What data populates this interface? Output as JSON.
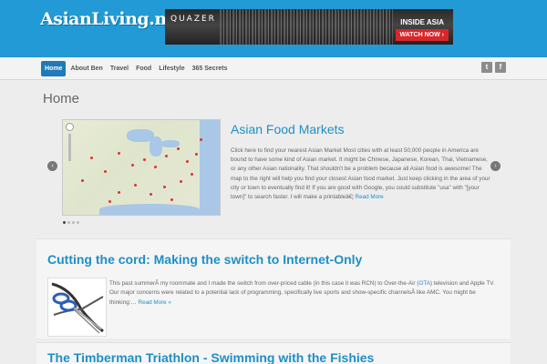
{
  "site": {
    "logo_text": "AsianLiving.me"
  },
  "ad": {
    "brand": "QUAZER",
    "headline": "INSIDE ASIA",
    "cta": "WATCH NOW ›"
  },
  "nav": {
    "items": [
      {
        "label": "Home",
        "active": true
      },
      {
        "label": "About Ben",
        "active": false
      },
      {
        "label": "Travel",
        "active": false
      },
      {
        "label": "Food",
        "active": false
      },
      {
        "label": "Lifestyle",
        "active": false
      },
      {
        "label": "365 Secrets",
        "active": false
      }
    ],
    "social": [
      {
        "name": "twitter",
        "glyph": "t"
      },
      {
        "name": "facebook",
        "glyph": "f"
      }
    ]
  },
  "page": {
    "title": "Home"
  },
  "slider": {
    "prev_glyph": "‹",
    "next_glyph": "›",
    "active_dot": 0,
    "dot_count": 4,
    "slide": {
      "title": "Asian Food Markets",
      "text": "Click here to find your nearest Asian Market Most cities with at least 50,000 people in America are bound to have some kind of Asian market. It might be Chinese, Japanese, Korean, Thai, Vietnamese, or any other Asian nationality. That shouldn't be a problem because all Asian food is awesome! The map to the right will help you find your closest Asian food market. Just keep clicking in the area of your city or town to eventually find it! If you are good with Google, you could substitute \"usa\" with \"[your town]\" to search faster. I will make a printableâ€¦",
      "read_more": "Read More"
    }
  },
  "posts": [
    {
      "title": "Cutting the cord: Making the switch to Internet-Only",
      "text_before": "This past summerÂ my roommate and I made the switch from over-priced cable (in this case it was RCN) to Over-the-Air (",
      "acronym": "OTA",
      "text_after": ") television and Apple TV. Our major concerns were related to a potential lack of programming, specifically live sports and show-specific channelsÂ like AMC. You might be thinking:…",
      "read_more": "Read More »"
    },
    {
      "title": "The Timberman Triathlon - Swimming with the Fishies"
    }
  ],
  "colors": {
    "header_bg": "#229ad6",
    "accent": "#1e8fc6",
    "nav_active": "#1e7ab8"
  }
}
